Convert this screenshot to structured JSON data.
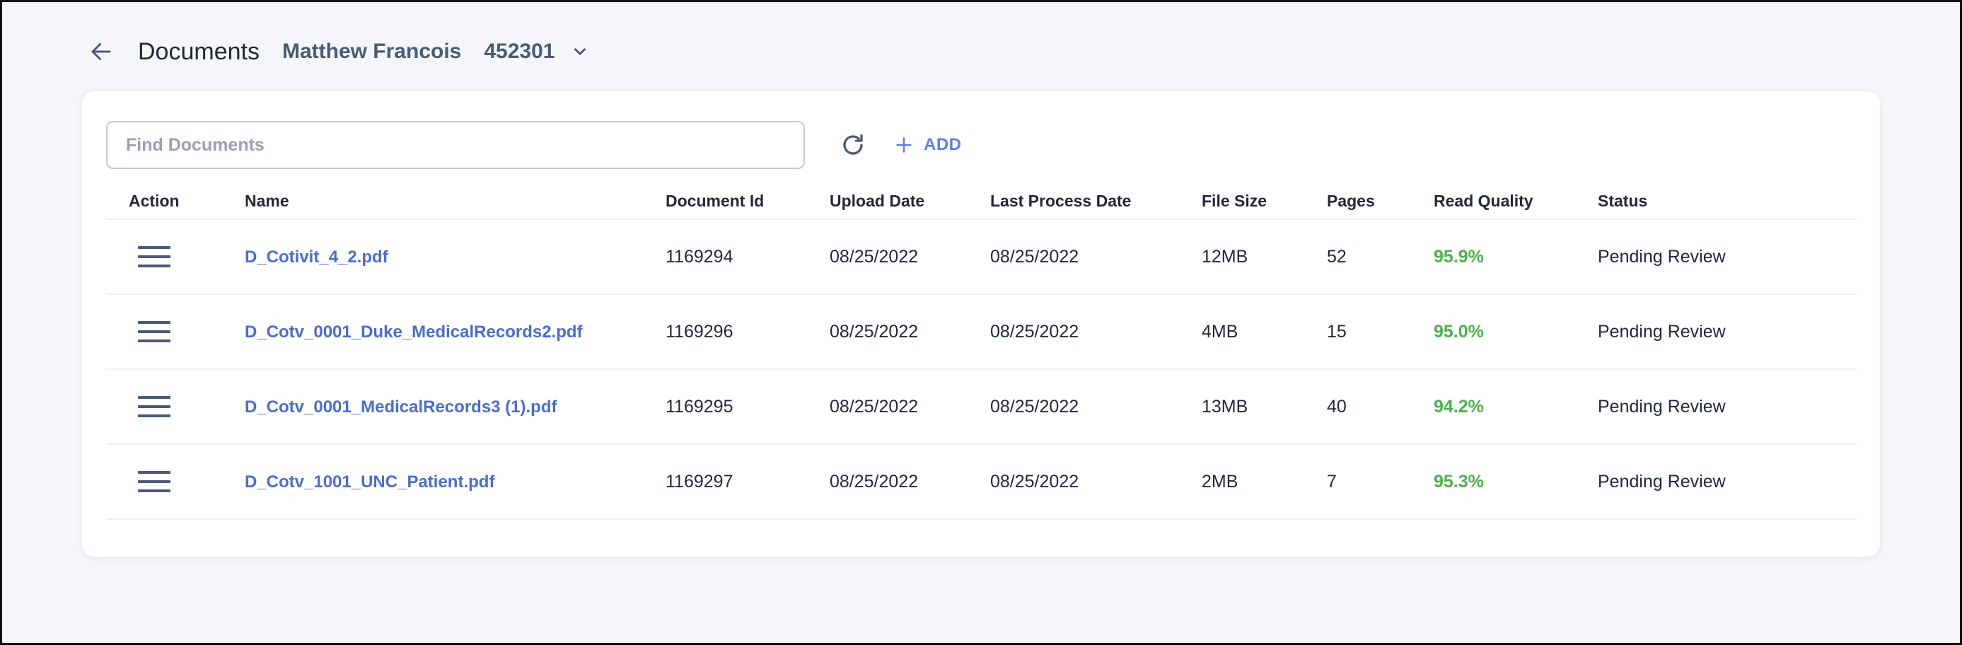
{
  "header": {
    "title": "Documents",
    "patient_name": "Matthew Francois",
    "patient_id": "452301"
  },
  "toolbar": {
    "search_placeholder": "Find Documents",
    "add_label": "ADD"
  },
  "table": {
    "columns": [
      "Action",
      "Name",
      "Document Id",
      "Upload Date",
      "Last Process Date",
      "File Size",
      "Pages",
      "Read Quality",
      "Status"
    ],
    "rows": [
      {
        "name": "D_Cotivit_4_2.pdf",
        "doc_id": "1169294",
        "upload": "08/25/2022",
        "processed": "08/25/2022",
        "size": "12MB",
        "pages": "52",
        "quality": "95.9%",
        "status": "Pending Review"
      },
      {
        "name": "D_Cotv_0001_Duke_MedicalRecords2.pdf",
        "doc_id": "1169296",
        "upload": "08/25/2022",
        "processed": "08/25/2022",
        "size": "4MB",
        "pages": "15",
        "quality": "95.0%",
        "status": "Pending Review"
      },
      {
        "name": "D_Cotv_0001_MedicalRecords3 (1).pdf",
        "doc_id": "1169295",
        "upload": "08/25/2022",
        "processed": "08/25/2022",
        "size": "13MB",
        "pages": "40",
        "quality": "94.2%",
        "status": "Pending Review"
      },
      {
        "name": "D_Cotv_1001_UNC_Patient.pdf",
        "doc_id": "1169297",
        "upload": "08/25/2022",
        "processed": "08/25/2022",
        "size": "2MB",
        "pages": "7",
        "quality": "95.3%",
        "status": "Pending Review"
      }
    ]
  },
  "icons": {
    "back": "arrow-left-icon",
    "dropdown": "chevron-down-icon",
    "refresh": "refresh-icon",
    "add": "plus-icon",
    "row_menu": "hamburger-menu-icon"
  },
  "colors": {
    "accent": "#5a82e6",
    "link": "#4a6cd4",
    "quality_good": "#4cb34a",
    "background": "#f4f6f9"
  }
}
